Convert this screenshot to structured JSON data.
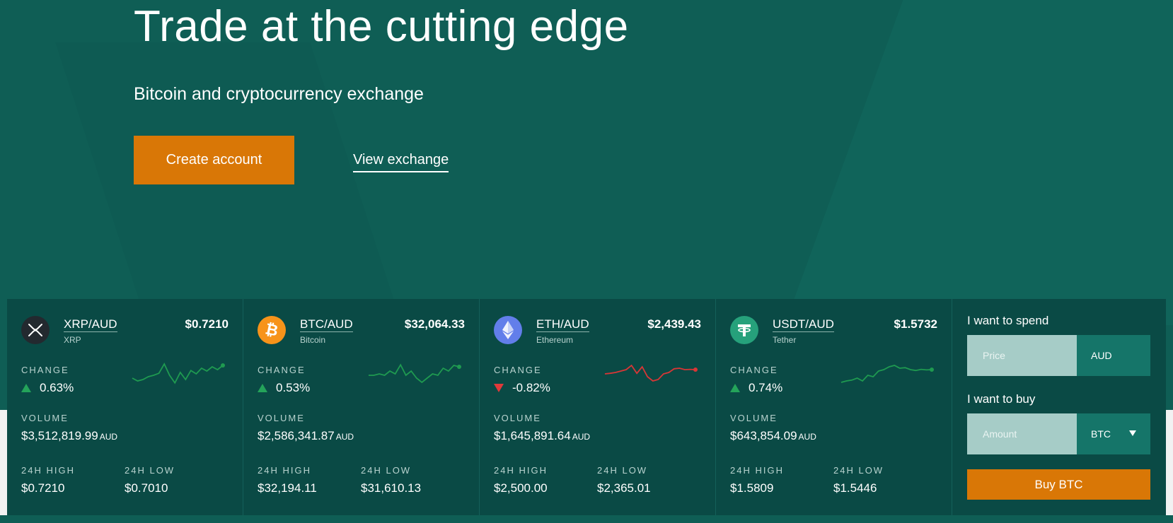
{
  "hero": {
    "title": "Trade at the cutting edge",
    "subtitle": "Bitcoin and cryptocurrency exchange",
    "create_label": "Create account",
    "view_label": "View exchange"
  },
  "labels": {
    "change": "CHANGE",
    "volume": "VOLUME",
    "high": "24H HIGH",
    "low": "24H LOW",
    "aud": "AUD"
  },
  "markets": [
    {
      "pair": "XRP/AUD",
      "name": "XRP",
      "price": "$0.7210",
      "icon": "xrp-icon",
      "icon_color": "#23292f",
      "change": "0.63%",
      "direction": "up",
      "volume": "$3,512,819.99",
      "high": "$0.7210",
      "low": "$0.7010",
      "trend": [
        0.45,
        0.35,
        0.4,
        0.5,
        0.55,
        0.62,
        0.95,
        0.55,
        0.28,
        0.65,
        0.4,
        0.72,
        0.6,
        0.8,
        0.7,
        0.85,
        0.75,
        0.9
      ]
    },
    {
      "pair": "BTC/AUD",
      "name": "Bitcoin",
      "price": "$32,064.33",
      "icon": "bitcoin-icon",
      "icon_color": "#f7931a",
      "change": "0.53%",
      "direction": "up",
      "volume": "$2,586,341.87",
      "high": "$32,194.11",
      "low": "$31,610.13",
      "trend": [
        0.55,
        0.55,
        0.6,
        0.55,
        0.7,
        0.6,
        0.92,
        0.55,
        0.7,
        0.45,
        0.3,
        0.45,
        0.6,
        0.55,
        0.8,
        0.7,
        0.9,
        0.85
      ]
    },
    {
      "pair": "ETH/AUD",
      "name": "Ethereum",
      "price": "$2,439.43",
      "icon": "ethereum-icon",
      "icon_color": "#627eea",
      "change": "-0.82%",
      "direction": "down",
      "volume": "$1,645,891.64",
      "high": "$2,500.00",
      "low": "$2,365.01",
      "trend": [
        0.6,
        0.62,
        0.65,
        0.7,
        0.75,
        0.9,
        0.62,
        0.85,
        0.5,
        0.35,
        0.4,
        0.6,
        0.65,
        0.78,
        0.8,
        0.75,
        0.76,
        0.75
      ]
    },
    {
      "pair": "USDT/AUD",
      "name": "Tether",
      "price": "$1.5732",
      "icon": "tether-icon",
      "icon_color": "#26a17b",
      "change": "0.74%",
      "direction": "up",
      "volume": "$643,854.09",
      "high": "$1.5809",
      "low": "$1.5446",
      "trend": [
        0.3,
        0.35,
        0.38,
        0.45,
        0.35,
        0.55,
        0.5,
        0.7,
        0.75,
        0.85,
        0.9,
        0.8,
        0.82,
        0.75,
        0.72,
        0.76,
        0.74,
        0.75
      ]
    }
  ],
  "colors": {
    "up": "#1f9a50",
    "down": "#d93636"
  },
  "trade": {
    "spend_label": "I want to spend",
    "price_placeholder": "Price",
    "spend_currency": "AUD",
    "buy_label": "I want to buy",
    "amount_placeholder": "Amount",
    "buy_currency": "BTC",
    "buy_button": "Buy BTC"
  }
}
